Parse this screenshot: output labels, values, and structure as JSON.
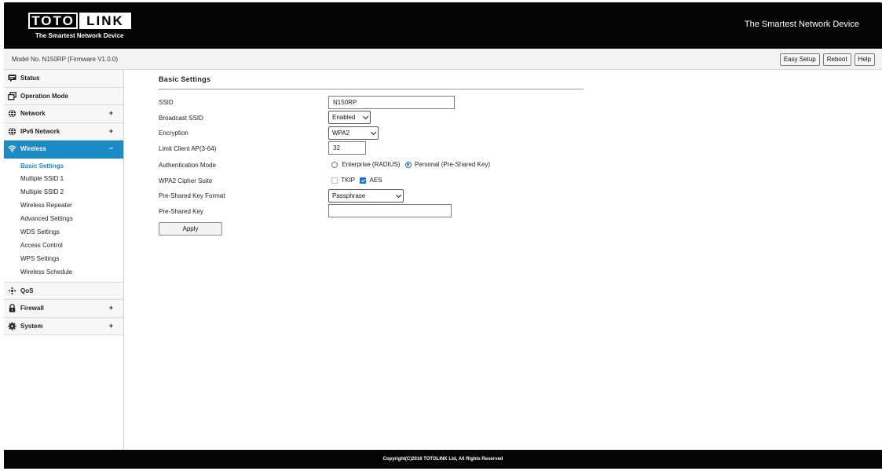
{
  "header": {
    "logo_left": "TOTO",
    "logo_right": "LINK",
    "logo_tagline": "The Smartest Network Device",
    "slogan": "The Smartest Network Device"
  },
  "modelbar": {
    "model_text": "Model No. N150RP (Firmware V1.0.0)",
    "buttons": [
      "Easy Setup",
      "Reboot",
      "Help"
    ]
  },
  "sidebar": {
    "items": [
      {
        "label": "Status",
        "icon": "status-icon",
        "expander": ""
      },
      {
        "label": "Operation Mode",
        "icon": "operation-mode-icon",
        "expander": ""
      },
      {
        "label": "Network",
        "icon": "globe-icon",
        "expander": "+"
      },
      {
        "label": "IPv6 Network",
        "icon": "globe-icon",
        "expander": "+"
      },
      {
        "label": "Wireless",
        "icon": "wifi-icon",
        "expander": "−"
      },
      {
        "label": "QoS",
        "icon": "qos-icon",
        "expander": ""
      },
      {
        "label": "Firewall",
        "icon": "lock-icon",
        "expander": "+"
      },
      {
        "label": "System",
        "icon": "gear-icon",
        "expander": "+"
      }
    ],
    "wireless_sub": [
      "Basic Settings",
      "Multiple SSID 1",
      "Multiple SSID 2",
      "Wireless Repeater",
      "Advanced Settings",
      "WDS Settings",
      "Access Control",
      "WPS Settings",
      "Wireless Schedule"
    ],
    "active_color": "#1b8ac5"
  },
  "main": {
    "title": "Basic Settings",
    "labels": {
      "ssid": "SSID",
      "broadcast": "Broadcast SSID",
      "encryption": "Encryption",
      "limit": "Limit Client AP(3-64)",
      "auth_mode": "Authentication Mode",
      "cipher": "WPA2 Cipher Suite",
      "psk_format": "Pre-Shared Key Format",
      "psk": "Pre-Shared Key"
    },
    "values": {
      "ssid": "N150RP",
      "broadcast": "Enabled",
      "encryption": "WPA2",
      "limit": "32",
      "auth_enterprise": "Enterprise (RADIUS)",
      "auth_personal": "Personal (Pre-Shared Key)",
      "cipher_tkip": "TKIP",
      "cipher_aes": "AES",
      "psk_format": "Passphrase",
      "psk": ""
    },
    "apply_label": "Apply"
  },
  "footer": {
    "copyright": "Copyright(C)2016 TOTOLINK Ltd, All Rights Reserved"
  }
}
